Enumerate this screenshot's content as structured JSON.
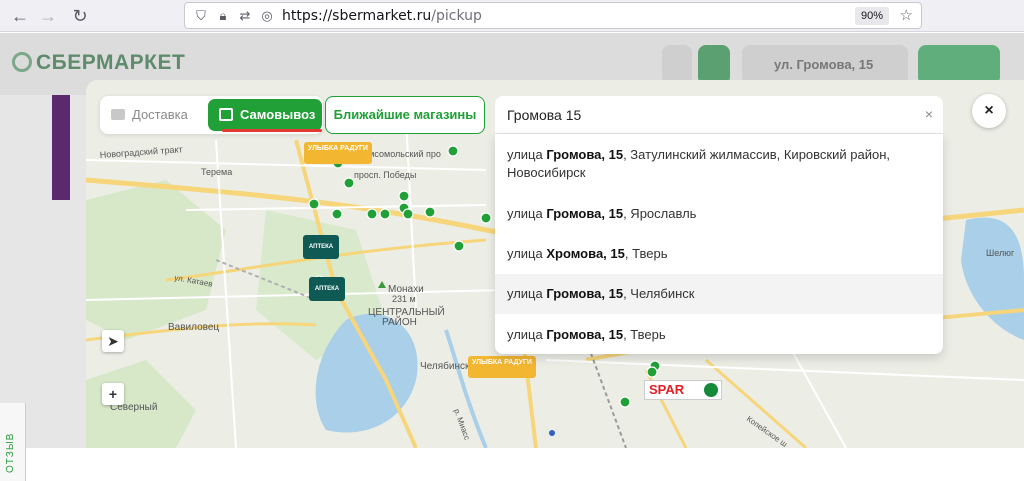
{
  "browser": {
    "url_host": "https://sbermarket.ru",
    "url_path": "/pickup",
    "zoom": "90%"
  },
  "page": {
    "logo": "СБЕРМАРКЕТ",
    "header_address": "ул. Громова, 15",
    "feedback_label": "ОТЗЫВ"
  },
  "modal": {
    "tabs": {
      "delivery": "Доставка",
      "pickup": "Самовывоз"
    },
    "nearest_button": "Ближайшие магазины",
    "search": {
      "value": "Громова 15",
      "clear": "×"
    },
    "close": "×",
    "suggestions": [
      {
        "pre": "улица ",
        "bold": "Громова, 15",
        "post": ", Затулинский жилмассив, Кировский район, Новосибирск"
      },
      {
        "pre": "улица ",
        "bold": "Громова, 15",
        "post": ", Ярославль"
      },
      {
        "pre": "улица ",
        "bold": "Хромова, 15",
        "post": ", Тверь"
      },
      {
        "pre": "улица ",
        "bold": "Громова, 15",
        "post": ", Челябинск"
      },
      {
        "pre": "улица ",
        "bold": "Громова, 15",
        "post": ", Тверь"
      }
    ],
    "map": {
      "labels": {
        "novogradsky": "Новоградский тракт",
        "terema": "Терема",
        "pobedy": "просп. Победы",
        "komsomolsky": "Комсомольский про",
        "monakhi": "Монахи",
        "monakhi_alt": "231 м",
        "central1": "ЦЕНТРАЛЬНЫЙ",
        "central2": "РАЙОН",
        "vavilovets": "Вавиловец",
        "chelyabinsk": "Челябинск",
        "severny": "Северный",
        "shelyug": "Шелюг",
        "kataev": "ул. Катаев",
        "miass": "р. Миасс",
        "kopeysk": "Копейское ш"
      },
      "pharmacy_label": "АПТЕКА",
      "ulybka_label": "УЛЫБКА РАДУГИ",
      "spar_label": "SPAR"
    },
    "controls": {
      "locate": "➤",
      "zoom_in": "+"
    }
  }
}
